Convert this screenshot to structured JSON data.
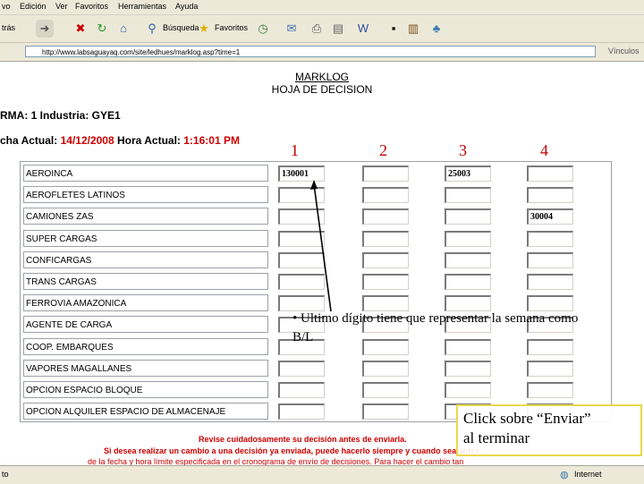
{
  "menu": [
    "vo",
    "Edición",
    "Ver",
    "Favoritos",
    "Herramientas",
    "Ayuda"
  ],
  "toolbar": {
    "atras_label": "trás",
    "busqueda_label": "Búsqueda",
    "favoritos_label": "Favoritos"
  },
  "address": {
    "url": "http://www.labsaguayaq.com/site/ledhues/marklog.asp?time=1"
  },
  "links_label": "Vínculos",
  "page": {
    "title": "MARKLOG",
    "subtitle": "HOJA DE DECISION",
    "firma_line": "RMA: 1 Industria: GYE1",
    "fecha_label": "cha Actual:",
    "fecha_value": "14/12/2008",
    "hora_label": "Hora Actual:",
    "hora_value": "1:16:01 PM"
  },
  "columns": [
    "1",
    "2",
    "3",
    "4"
  ],
  "rows": [
    {
      "label": "AEROINCA",
      "values": [
        "130001",
        "",
        "25003",
        ""
      ]
    },
    {
      "label": "AEROFLETES LATINOS",
      "values": [
        "",
        "",
        "",
        ""
      ]
    },
    {
      "label": "CAMIONES ZAS",
      "values": [
        "",
        "",
        "",
        "30004"
      ]
    },
    {
      "label": "SUPER CARGAS",
      "values": [
        "",
        "",
        "",
        ""
      ]
    },
    {
      "label": "CONFICARGAS",
      "values": [
        "",
        "",
        "",
        ""
      ]
    },
    {
      "label": "TRANS CARGAS",
      "values": [
        "",
        "",
        "",
        ""
      ]
    },
    {
      "label": "FERROVIA AMAZONICA",
      "values": [
        "",
        "",
        "",
        ""
      ]
    },
    {
      "label": "AGENTE DE CARGA",
      "values": [
        "",
        "",
        "",
        ""
      ]
    },
    {
      "label": "COOP. EMBARQUES",
      "values": [
        "",
        "",
        "",
        ""
      ]
    },
    {
      "label": "VAPORES MAGALLANES",
      "values": [
        "",
        "",
        "",
        ""
      ]
    },
    {
      "label": "OPCION ESPACIO BLOQUE",
      "values": [
        "",
        "",
        "",
        ""
      ]
    },
    {
      "label": "OPCION ALQUILER ESPACIO DE ALMACENAJE",
      "values": [
        "",
        "",
        "",
        ""
      ]
    }
  ],
  "callout": {
    "text": "• Ultimo dígito tiene que representar la semana como B/L"
  },
  "click_hint": {
    "line1": "Click sobre “Enviar”",
    "line2": "al terminar"
  },
  "notes": {
    "line1": "Revise cuidadosamente su decisión antes de enviarla.",
    "line2": "Si desea realizar un cambio a una decisión ya enviada, puede hacerlo siempre y cuando sea antes",
    "line3": "de la fecha y hora límite especificada en el cronograma de envío de decisiones. Para hacer el cambio tan"
  },
  "status": {
    "left": "to",
    "zone": "Internet"
  },
  "colors": {
    "red": "#cc0000",
    "accent_red": "#c00000",
    "callout_border": "#e8d84a"
  }
}
